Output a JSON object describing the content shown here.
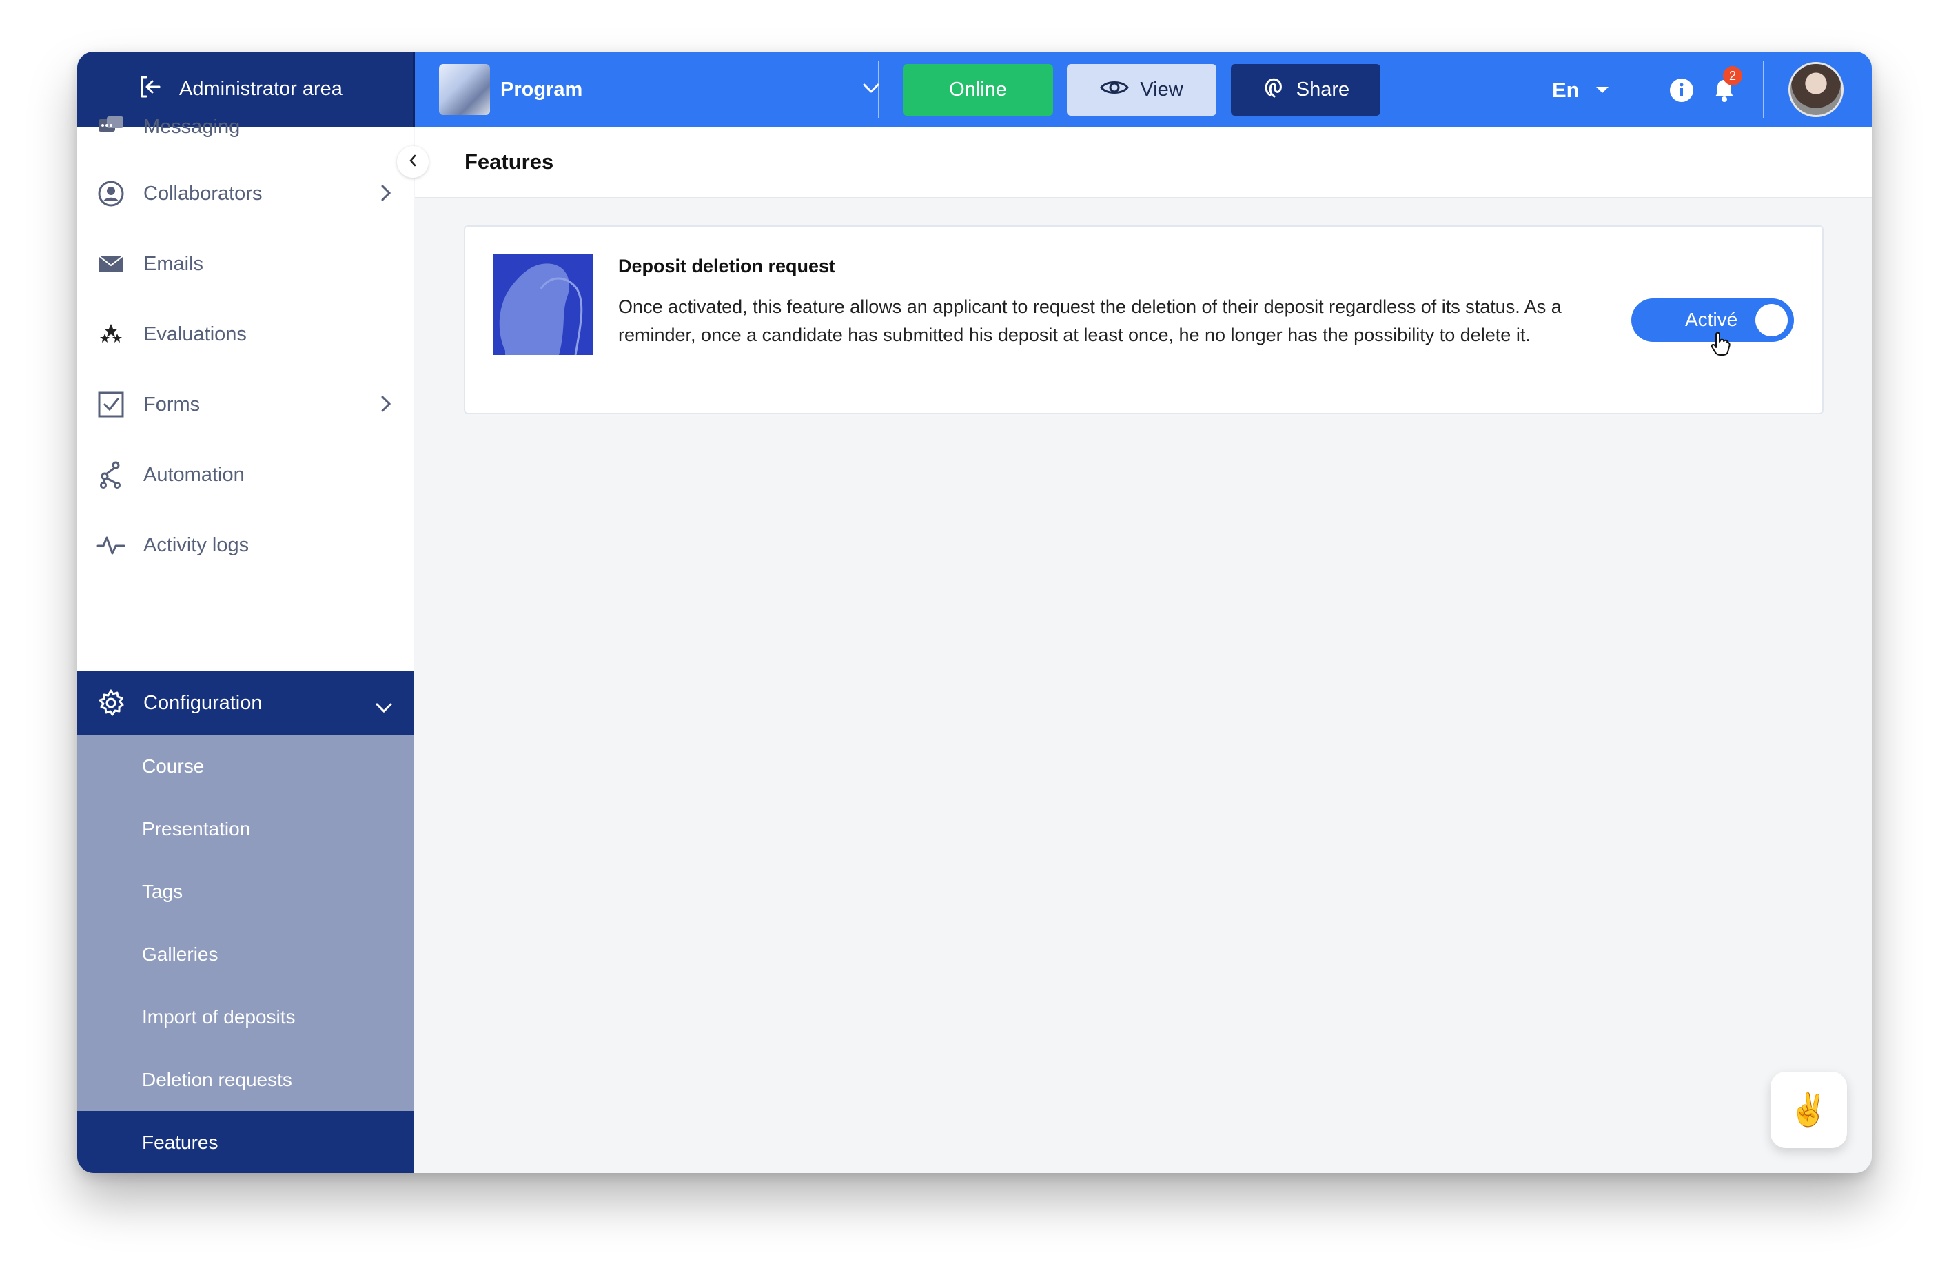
{
  "header": {
    "admin_label": "Administrator area",
    "program_label": "Program",
    "online_label": "Online",
    "view_label": "View",
    "share_label": "Share",
    "language": "En",
    "notification_count": "2"
  },
  "sidebar": {
    "items": [
      {
        "label": "Messaging",
        "icon": "chat-icon"
      },
      {
        "label": "Collaborators",
        "icon": "user-icon"
      },
      {
        "label": "Emails",
        "icon": "envelope-icon"
      },
      {
        "label": "Evaluations",
        "icon": "stars-icon"
      },
      {
        "label": "Forms",
        "icon": "checkbox-icon"
      },
      {
        "label": "Automation",
        "icon": "flow-icon"
      },
      {
        "label": "Activity logs",
        "icon": "pulse-icon"
      }
    ],
    "config": {
      "label": "Configuration",
      "subitems": [
        "Course",
        "Presentation",
        "Tags",
        "Galleries",
        "Import of deposits",
        "Deletion requests",
        "Features"
      ]
    }
  },
  "main": {
    "title": "Features",
    "feature": {
      "title": "Deposit deletion request",
      "description": "Once activated, this feature allows an applicant to request the deletion of their deposit regardless of its status. As a reminder, once a candidate has submitted his deposit at least once, he no longer has the possibility to delete it.",
      "toggle_label": "Activé",
      "enabled": true
    }
  },
  "help_button": "✌️",
  "colors": {
    "topbar": "#2f77f3",
    "navy": "#17327c",
    "online_green": "#22c06a",
    "submenu": "#8f9cbd"
  }
}
